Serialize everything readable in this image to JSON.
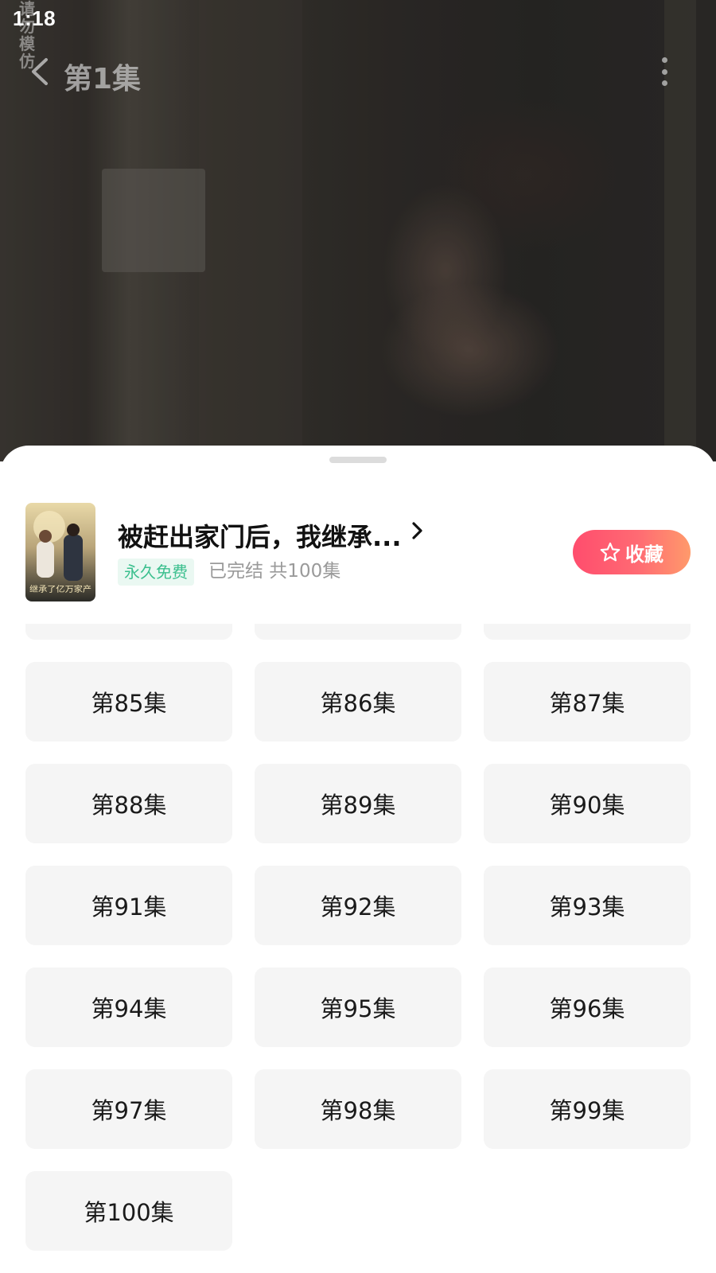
{
  "status_bar": {
    "time": "1:18"
  },
  "player": {
    "watermark": [
      "请",
      "勿",
      "模",
      "仿"
    ],
    "episode_title": "第1集",
    "icons": {
      "back": "chevron-left-icon",
      "more": "more-vertical-icon"
    }
  },
  "drama": {
    "title": "被赶出家门后，我继承...",
    "free_badge": "永久免费",
    "status": "已完结 共100集",
    "favorite_label": "收藏",
    "cover_art_text": "继承了亿万家产",
    "accent_gradient": [
      "#ff4d6d",
      "#ff9a6b"
    ],
    "badge_color": "#3bbf8e"
  },
  "episodes": {
    "partial_row": [
      "",
      "",
      ""
    ],
    "items": [
      "第85集",
      "第86集",
      "第87集",
      "第88集",
      "第89集",
      "第90集",
      "第91集",
      "第92集",
      "第93集",
      "第94集",
      "第95集",
      "第96集",
      "第97集",
      "第98集",
      "第99集",
      "第100集"
    ]
  }
}
